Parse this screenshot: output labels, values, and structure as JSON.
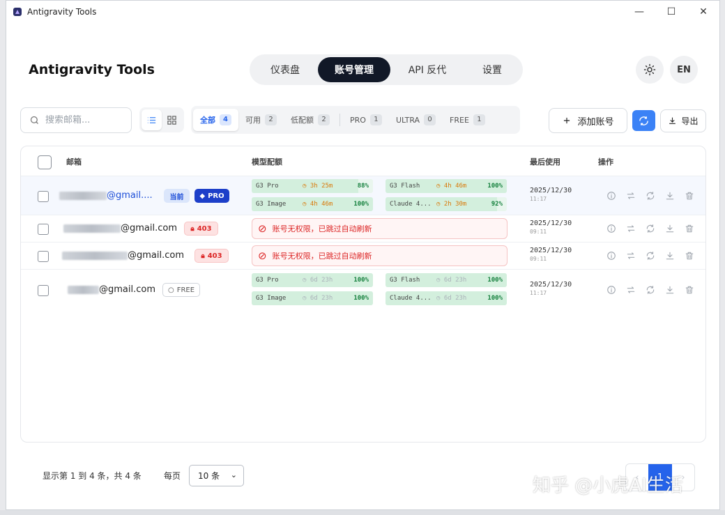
{
  "window": {
    "title": "Antigravity Tools",
    "controls": [
      "—",
      "☐",
      "✕"
    ]
  },
  "header": {
    "brand": "Antigravity Tools",
    "nav": [
      {
        "label": "仪表盘",
        "active": false
      },
      {
        "label": "账号管理",
        "active": true
      },
      {
        "label": "API 反代",
        "active": false
      },
      {
        "label": "设置",
        "active": false
      }
    ],
    "theme_icon": "sun-icon",
    "lang": "EN"
  },
  "toolbar": {
    "search_placeholder": "搜索邮箱...",
    "filters": [
      {
        "label": "全部",
        "count": "4",
        "active": true
      },
      {
        "label": "可用",
        "count": "2"
      },
      {
        "label": "低配额",
        "count": "2"
      },
      {
        "label": "PRO",
        "count": "1"
      },
      {
        "label": "ULTRA",
        "count": "0"
      },
      {
        "label": "FREE",
        "count": "1"
      }
    ],
    "add_label": "添加账号",
    "export_label": "导出",
    "accent_color": "#3b82f6"
  },
  "table": {
    "columns": {
      "email": "邮箱",
      "quota": "模型配额",
      "last_used": "最后使用",
      "actions": "操作"
    },
    "rows": [
      {
        "email": "@gmail....",
        "badges": [
          "当前",
          "PRO"
        ],
        "quotas": [
          {
            "name": "G3 Pro",
            "time": "3h 25m",
            "pct": "88%",
            "fill": 0.88
          },
          {
            "name": "G3 Flash",
            "time": "4h 46m",
            "pct": "100%",
            "fill": 1.0
          },
          {
            "name": "G3 Image",
            "time": "4h 46m",
            "pct": "100%",
            "fill": 1.0
          },
          {
            "name": "Claude 4...",
            "time": "2h 30m",
            "pct": "92%",
            "fill": 0.92
          }
        ],
        "date": "2025/12/30",
        "time": "11:17"
      },
      {
        "email": "@gmail.com",
        "badge": "403",
        "error": "账号无权限，已跳过自动刷新",
        "date": "2025/12/30",
        "time": "09:11"
      },
      {
        "email": "@gmail.com",
        "badge": "403",
        "error": "账号无权限，已跳过自动刷新",
        "date": "2025/12/30",
        "time": "09:11"
      },
      {
        "email": "@gmail.com",
        "badge": "FREE",
        "quotas": [
          {
            "name": "G3 Pro",
            "time": "6d 23h",
            "pct": "100%",
            "fill": 1.0
          },
          {
            "name": "G3 Flash",
            "time": "6d 23h",
            "pct": "100%",
            "fill": 1.0
          },
          {
            "name": "G3 Image",
            "time": "6d 23h",
            "pct": "100%",
            "fill": 1.0
          },
          {
            "name": "Claude 4...",
            "time": "6d 23h",
            "pct": "100%",
            "fill": 1.0
          }
        ],
        "date": "2025/12/30",
        "time": "11:17"
      }
    ],
    "action_icons": [
      "info-icon",
      "switch-icon",
      "refresh-icon",
      "download-icon",
      "trash-icon"
    ]
  },
  "footer": {
    "info": "显示第 1 到 4 条，共 4 条",
    "per_page_label": "每页",
    "per_page_value": "10 条",
    "pager_prev": "‹",
    "pager_current": "1",
    "pager_next": "›"
  },
  "watermark": "知乎 @小虎AI生活"
}
